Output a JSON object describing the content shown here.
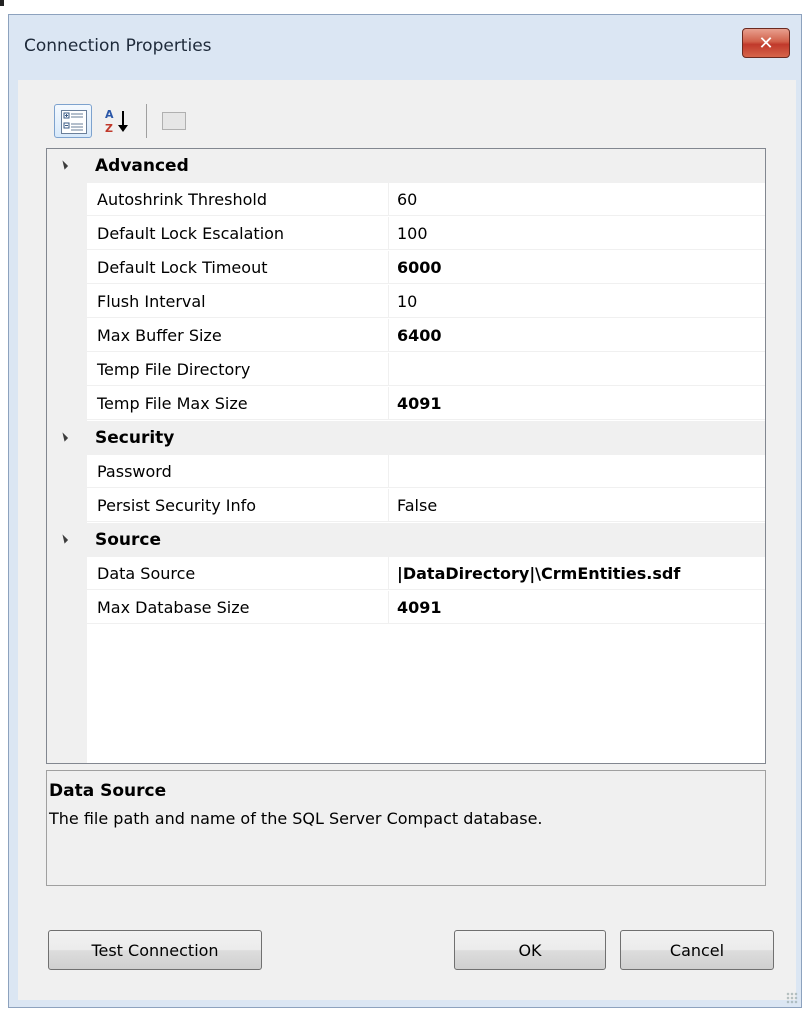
{
  "window": {
    "title": "Connection Properties",
    "close_glyph": "✕"
  },
  "toolbar": {
    "categorized_icon": "categorized-view-icon",
    "alphabetical_label": "A↓Z",
    "alphabetical_icon": "sort-alphabetical-icon",
    "property_pages_icon": "property-pages-icon"
  },
  "grid": {
    "categories": [
      {
        "label": "Advanced",
        "properties": [
          {
            "name": "Autoshrink Threshold",
            "value": "60",
            "bold": false
          },
          {
            "name": "Default Lock Escalation",
            "value": "100",
            "bold": false
          },
          {
            "name": "Default Lock Timeout",
            "value": "6000",
            "bold": true
          },
          {
            "name": "Flush Interval",
            "value": "10",
            "bold": false
          },
          {
            "name": "Max Buffer Size",
            "value": "6400",
            "bold": true
          },
          {
            "name": "Temp File Directory",
            "value": "",
            "bold": false
          },
          {
            "name": "Temp File Max Size",
            "value": "4091",
            "bold": true
          }
        ]
      },
      {
        "label": "Security",
        "properties": [
          {
            "name": "Password",
            "value": "",
            "bold": false
          },
          {
            "name": "Persist Security Info",
            "value": "False",
            "bold": false
          }
        ]
      },
      {
        "label": "Source",
        "properties": [
          {
            "name": "Data Source",
            "value": "|DataDirectory|\\CrmEntities.sdf",
            "bold": true
          },
          {
            "name": "Max Database Size",
            "value": "4091",
            "bold": true
          }
        ]
      }
    ]
  },
  "description": {
    "title": "Data Source",
    "text": "The file path and name of the SQL Server Compact database."
  },
  "buttons": {
    "test_connection": "Test Connection",
    "ok": "OK",
    "cancel": "Cancel"
  }
}
